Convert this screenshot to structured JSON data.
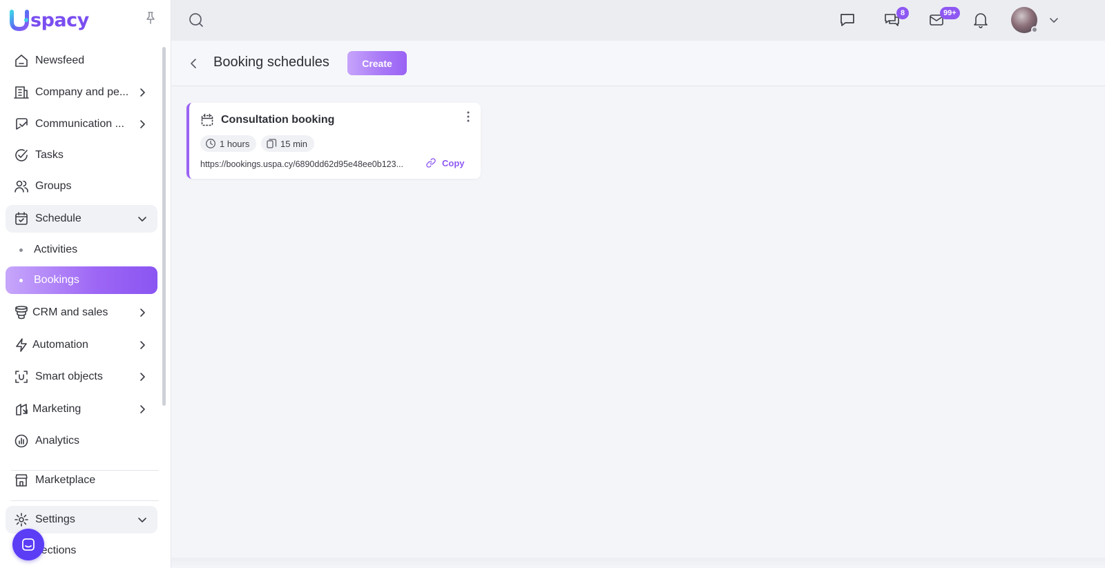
{
  "app": {
    "logo_text": "spacy",
    "brand_color": "#8e58f2"
  },
  "sidebar": {
    "items": [
      {
        "label": "Newsfeed",
        "icon": "home-icon"
      },
      {
        "label": "Company and pe...",
        "icon": "building-icon"
      },
      {
        "label": "Communication ...",
        "icon": "communication-icon"
      },
      {
        "label": "Tasks",
        "icon": "check-circle-icon"
      },
      {
        "label": "Groups",
        "icon": "users-icon"
      },
      {
        "label": "Schedule",
        "icon": "calendar-check-icon"
      },
      {
        "label": "CRM and sales",
        "icon": "funnel-icon"
      },
      {
        "label": "Automation",
        "icon": "lightning-icon"
      },
      {
        "label": "Smart objects",
        "icon": "smart-object-icon"
      },
      {
        "label": "Marketing",
        "icon": "marketing-icon"
      },
      {
        "label": "Analytics",
        "icon": "chart-pie-icon"
      },
      {
        "label": "Marketplace",
        "icon": "store-icon"
      },
      {
        "label": "Settings",
        "icon": "gear-icon"
      }
    ],
    "schedule_sub": [
      {
        "label": "Activities"
      },
      {
        "label": "Bookings"
      }
    ],
    "settings_sub": [
      {
        "label": "Sections"
      }
    ]
  },
  "topbar": {
    "chat_badge": "8",
    "mail_badge": "99+"
  },
  "page": {
    "title": "Booking schedules",
    "create_label": "Create"
  },
  "card": {
    "title": "Consultation booking",
    "duration": "1 hours",
    "interval": "15 min",
    "url": "https://bookings.uspa.cy/6890dd62d95e48ee0b123...",
    "copy_label": "Copy"
  }
}
